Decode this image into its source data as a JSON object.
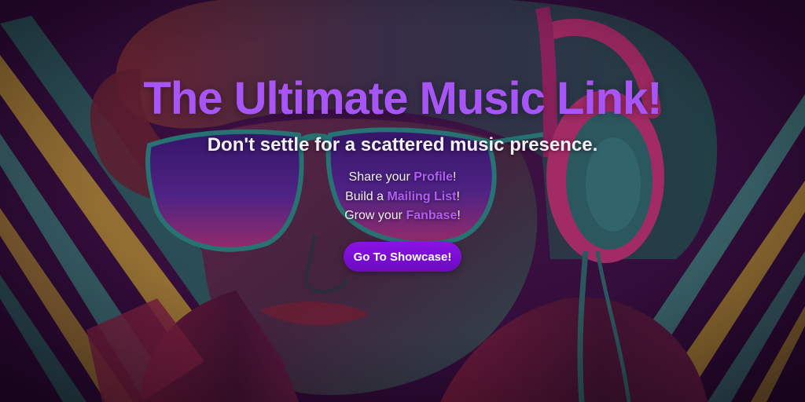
{
  "hero": {
    "title": "The Ultimate Music Link!",
    "subtitle": "Don't settle for a scattered music presence.",
    "lines": [
      {
        "before": "Share your ",
        "highlight": "Profile",
        "after": "!"
      },
      {
        "before": "Build a ",
        "highlight": "Mailing List",
        "after": "!"
      },
      {
        "before": "Grow your ",
        "highlight": "Fanbase",
        "after": "!"
      }
    ],
    "cta_label": "Go To Showcase!"
  },
  "background": {
    "subject": "retro-illustrated person wearing aviator sunglasses and headphones",
    "colors": {
      "purple_base": "#3b0d45",
      "magenta": "#8e1f55",
      "teal": "#2e6b6b",
      "stripe_yellow": "#c9a233",
      "stripe_teal": "#3f8a82"
    }
  },
  "colors": {
    "title": "#a855f7",
    "highlight": "#b05cf5",
    "cta_background": "#7c0fd8",
    "text": "#f3f0f5"
  }
}
